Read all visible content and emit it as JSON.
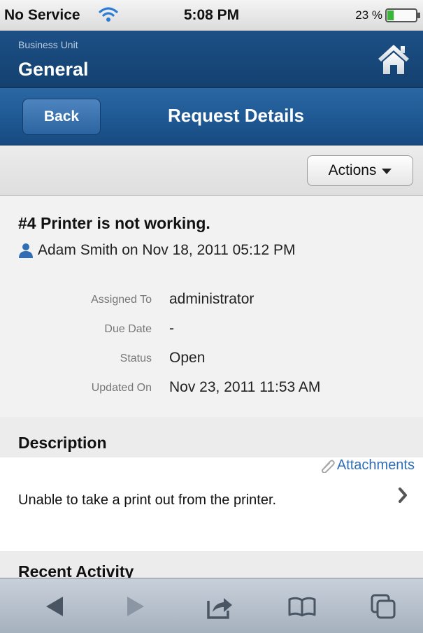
{
  "status_bar": {
    "carrier": "No Service",
    "time": "5:08 PM",
    "battery_percent": "23 %",
    "battery_level": 0.23
  },
  "header": {
    "caption": "Business Unit",
    "business_unit": "General",
    "home_icon": "home-icon"
  },
  "navbar": {
    "back_label": "Back",
    "title": "Request Details"
  },
  "actions": {
    "label": "Actions"
  },
  "request": {
    "title": "#4 Printer is not working.",
    "meta": "Adam Smith on Nov 18, 2011 05:12 PM",
    "fields": [
      {
        "key": "Assigned To",
        "value": "administrator"
      },
      {
        "key": "Due Date",
        "value": "-"
      },
      {
        "key": "Status",
        "value": "Open"
      },
      {
        "key": "Updated On",
        "value": "Nov 23, 2011 11:53 AM"
      }
    ]
  },
  "description": {
    "heading": "Description",
    "attachments_label": "Attachments",
    "text": "Unable to take a print out from the printer."
  },
  "recent_activity": {
    "heading": "Recent Activity"
  },
  "toolbar": {
    "icons": [
      "back-arrow-icon",
      "forward-arrow-icon",
      "share-icon",
      "bookmarks-icon",
      "tabs-icon"
    ]
  },
  "colors": {
    "header_blue": "#1d5086",
    "nav_blue": "#1f5a95",
    "link_blue": "#2f6eb5"
  }
}
